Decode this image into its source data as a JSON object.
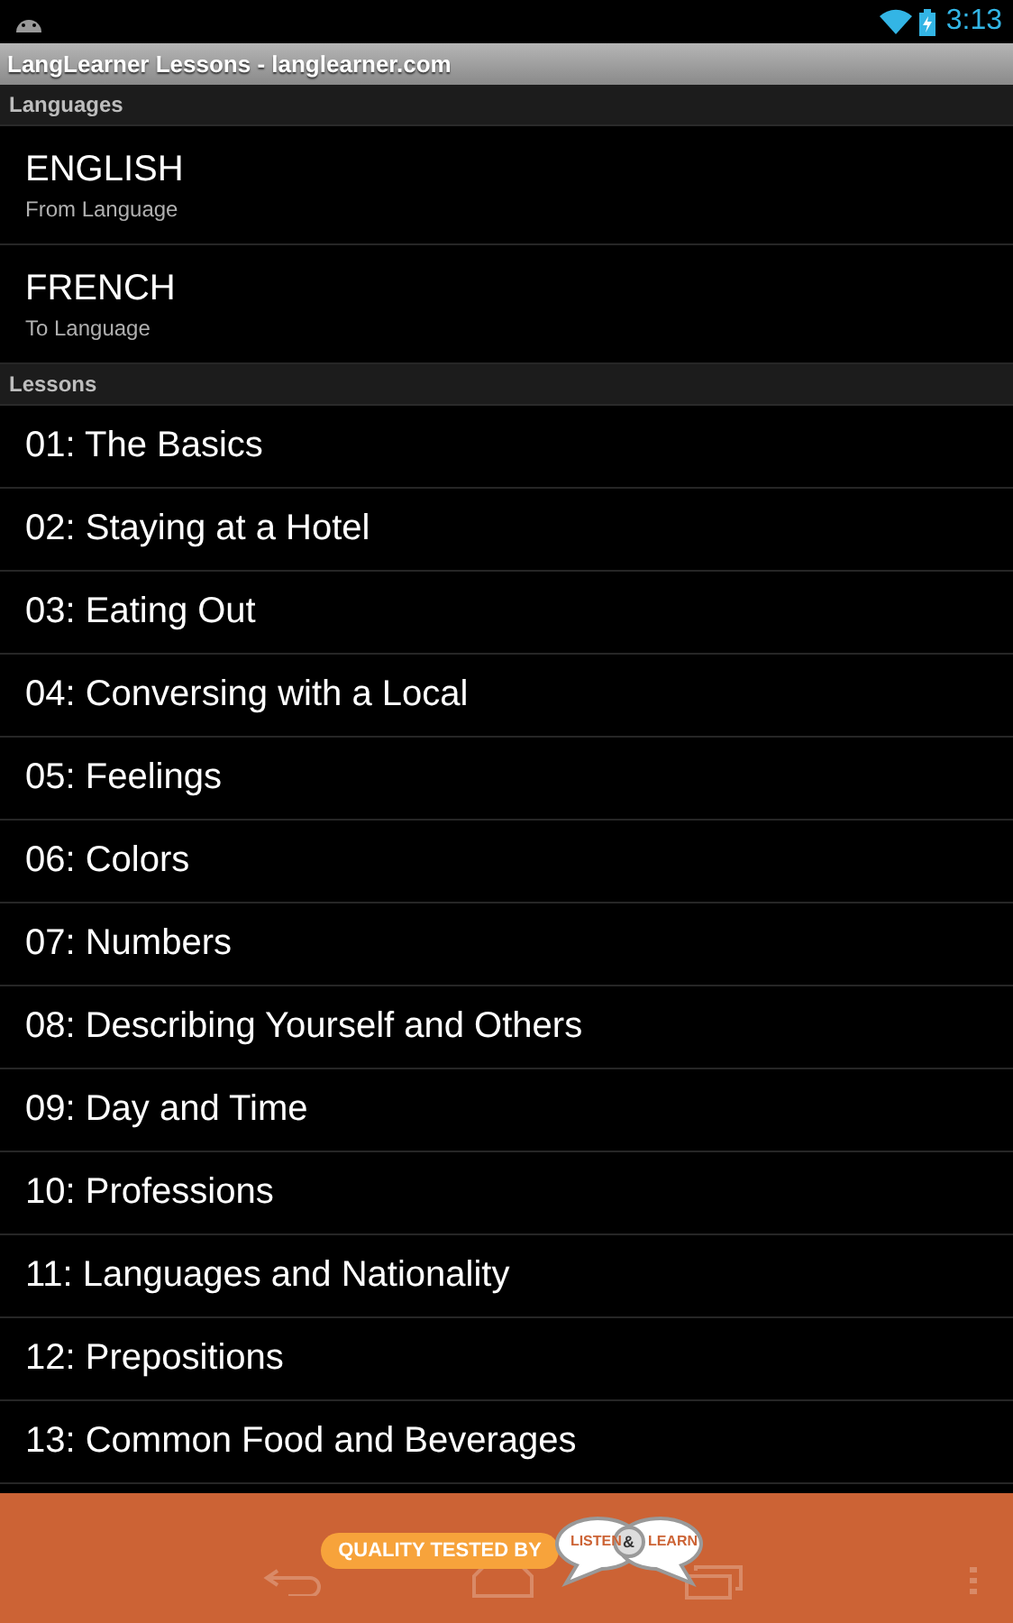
{
  "status_bar": {
    "time": "3:13"
  },
  "window": {
    "title": "LangLearner Lessons - langlearner.com"
  },
  "languages": {
    "header": "Languages",
    "items": [
      {
        "name": "ENGLISH",
        "caption": "From Language"
      },
      {
        "name": "FRENCH",
        "caption": "To Language"
      }
    ]
  },
  "lessons": {
    "header": "Lessons",
    "items": [
      "01: The Basics",
      "02: Staying at a Hotel",
      "03: Eating Out",
      "04: Conversing with a Local",
      "05: Feelings",
      "06: Colors",
      "07: Numbers",
      "08: Describing Yourself and Others",
      "09: Day and Time",
      "10: Professions",
      "11: Languages and Nationality",
      "12: Prepositions",
      "13: Common Food and Beverages"
    ]
  },
  "banner": {
    "tagline": "QUALITY TESTED BY",
    "bubble_left": "LISTEN",
    "ampersand": "&",
    "bubble_right": "LEARN"
  }
}
